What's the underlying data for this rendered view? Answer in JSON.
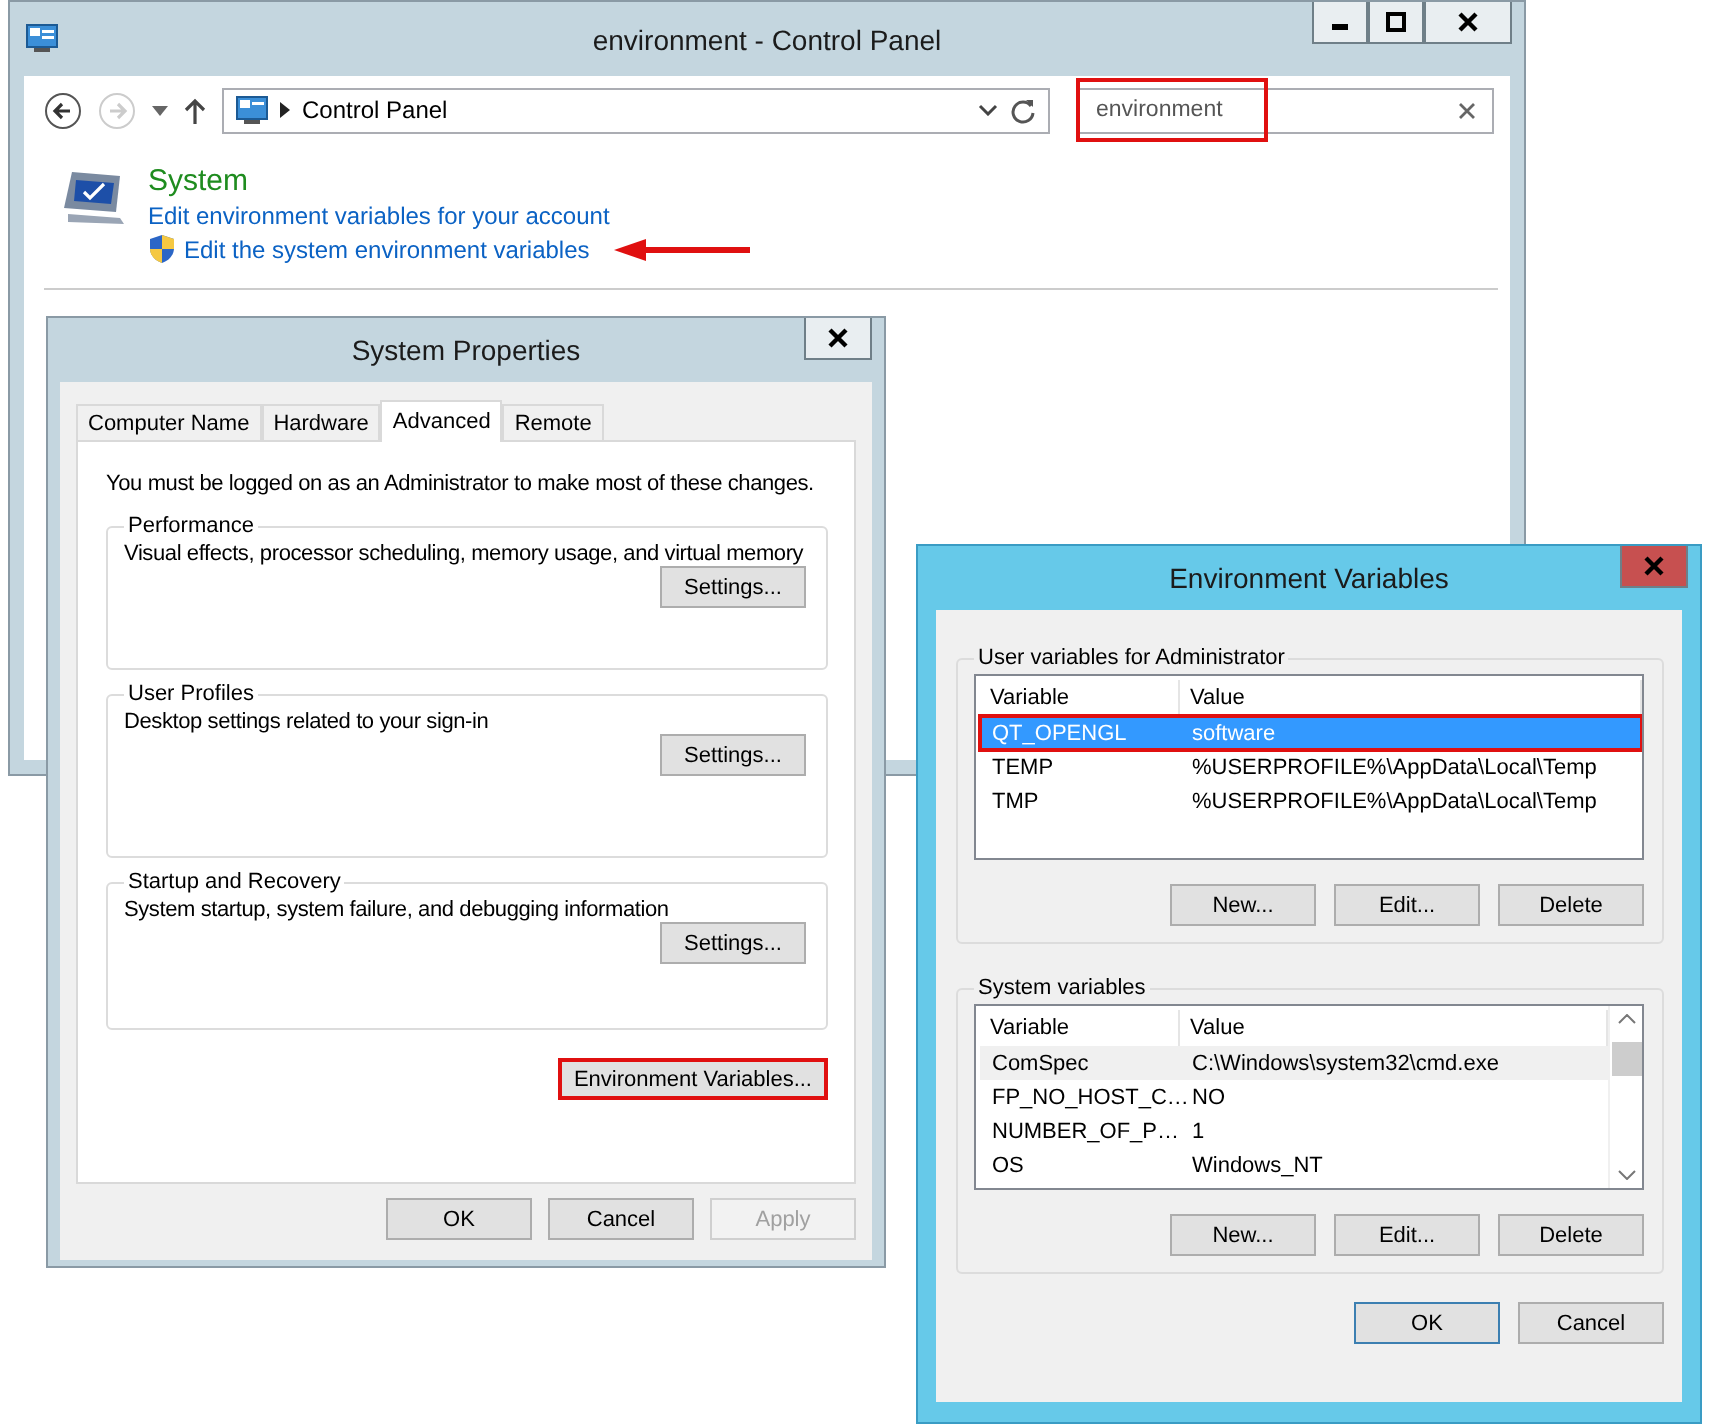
{
  "control_panel": {
    "title": "environment - Control Panel",
    "address": "Control Panel",
    "search": {
      "value": "environment",
      "highlighted": true
    },
    "result": {
      "heading": "System",
      "links": [
        {
          "label": "Edit environment variables for your account",
          "shield": false,
          "arrow": false
        },
        {
          "label": "Edit the system environment variables",
          "shield": true,
          "arrow": true
        }
      ]
    }
  },
  "system_properties": {
    "title": "System Properties",
    "tabs": [
      {
        "label": "Computer Name",
        "selected": false
      },
      {
        "label": "Hardware",
        "selected": false
      },
      {
        "label": "Advanced",
        "selected": true
      },
      {
        "label": "Remote",
        "selected": false
      }
    ],
    "notice": "You must be logged on as an Administrator to make most of these changes.",
    "groups": [
      {
        "title": "Performance",
        "description": "Visual effects, processor scheduling, memory usage, and virtual memory",
        "button": "Settings..."
      },
      {
        "title": "User Profiles",
        "description": "Desktop settings related to your sign-in",
        "button": "Settings..."
      },
      {
        "title": "Startup and Recovery",
        "description": "System startup, system failure, and debugging information",
        "button": "Settings..."
      }
    ],
    "env_button": {
      "label": "Environment Variables...",
      "highlighted": true
    },
    "buttons": [
      {
        "label": "OK",
        "disabled": false
      },
      {
        "label": "Cancel",
        "disabled": false
      },
      {
        "label": "Apply",
        "disabled": true
      }
    ]
  },
  "environment_variables": {
    "title": "Environment Variables",
    "sections": [
      {
        "title": "User variables for Administrator",
        "columns": [
          "Variable",
          "Value"
        ],
        "scrollbar": false,
        "rows": [
          {
            "variable": "QT_OPENGL",
            "value": "software",
            "selected": true,
            "highlighted": true,
            "hovered": false
          },
          {
            "variable": "TEMP",
            "value": "%USERPROFILE%\\AppData\\Local\\Temp",
            "selected": false,
            "highlighted": false,
            "hovered": false
          },
          {
            "variable": "TMP",
            "value": "%USERPROFILE%\\AppData\\Local\\Temp",
            "selected": false,
            "highlighted": false,
            "hovered": false
          }
        ],
        "buttons": [
          "New...",
          "Edit...",
          "Delete"
        ]
      },
      {
        "title": "System variables",
        "columns": [
          "Variable",
          "Value"
        ],
        "scrollbar": true,
        "rows": [
          {
            "variable": "ComSpec",
            "value": "C:\\Windows\\system32\\cmd.exe",
            "selected": false,
            "highlighted": false,
            "hovered": true
          },
          {
            "variable": "FP_NO_HOST_C…",
            "value": "NO",
            "selected": false,
            "highlighted": false,
            "hovered": false
          },
          {
            "variable": "NUMBER_OF_P…",
            "value": "1",
            "selected": false,
            "highlighted": false,
            "hovered": false
          },
          {
            "variable": "OS",
            "value": "Windows_NT",
            "selected": false,
            "highlighted": false,
            "hovered": false
          }
        ],
        "buttons": [
          "New...",
          "Edit...",
          "Delete"
        ]
      }
    ],
    "buttons": [
      {
        "label": "OK",
        "default": true
      },
      {
        "label": "Cancel",
        "default": false
      }
    ]
  }
}
